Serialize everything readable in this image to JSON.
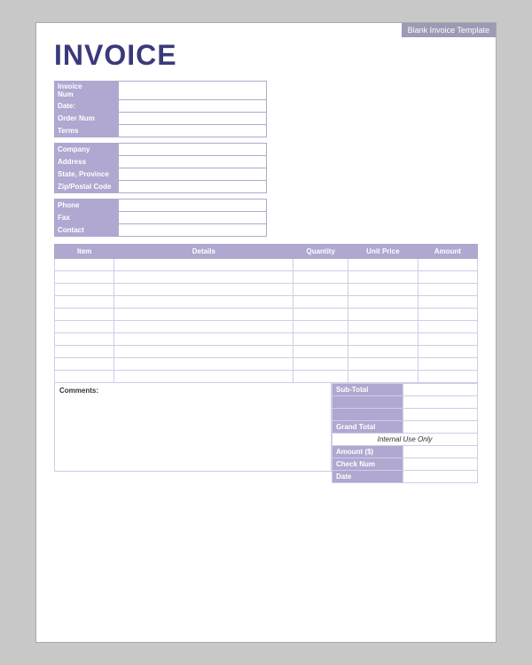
{
  "template": {
    "label": "Blank Invoice Template"
  },
  "header": {
    "title": "INVOICE"
  },
  "invoice_info": [
    {
      "label": "Invoice Num",
      "value": ""
    },
    {
      "label": "Date:",
      "value": ""
    },
    {
      "label": "Order Num",
      "value": ""
    },
    {
      "label": "Terms",
      "value": ""
    }
  ],
  "company_info": [
    {
      "label": "Company",
      "value": ""
    },
    {
      "label": "Address",
      "value": ""
    },
    {
      "label": "State, Province",
      "value": ""
    },
    {
      "label": "Zip/Postal Code",
      "value": ""
    }
  ],
  "contact_info": [
    {
      "label": "Phone",
      "value": ""
    },
    {
      "label": "Fax",
      "value": ""
    },
    {
      "label": "Contact",
      "value": ""
    }
  ],
  "table": {
    "headers": [
      "Item",
      "Details",
      "Quantity",
      "Unit Price",
      "Amount"
    ],
    "rows": 10
  },
  "comments_label": "Comments:",
  "totals": {
    "sub_total_label": "Sub-Total",
    "sub_total_value": "",
    "row2_label": "",
    "row2_value": "",
    "row3_label": "",
    "row3_value": "",
    "grand_total_label": "Grand Total",
    "grand_total_value": "",
    "internal_use_text": "Internal Use Only",
    "payment_rows": [
      {
        "label": "Amount ($)",
        "value": ""
      },
      {
        "label": "Check Num",
        "value": ""
      },
      {
        "label": "Date",
        "value": ""
      }
    ]
  }
}
